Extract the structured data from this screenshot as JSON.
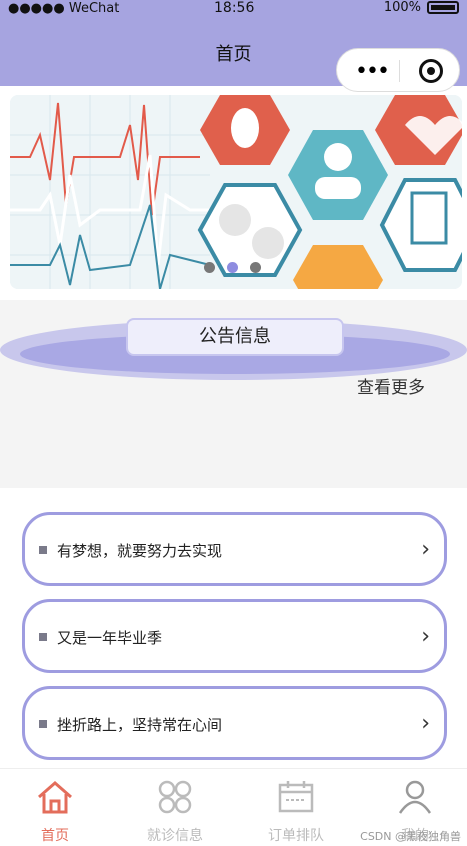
{
  "status": {
    "signal": "●●●●● WeChat",
    "time": "18:56",
    "battery": "100%"
  },
  "nav": {
    "title": "首页"
  },
  "notice": {
    "title": "公告信息",
    "more": "查看更多"
  },
  "list": [
    {
      "text": "有梦想，就要努力去实现"
    },
    {
      "text": "又是一年毕业季"
    },
    {
      "text": "挫折路上，坚持常在心间"
    }
  ],
  "tabs": [
    {
      "label": "首页",
      "active": true
    },
    {
      "label": "就诊信息",
      "active": false
    },
    {
      "label": "订单排队",
      "active": false
    },
    {
      "label": "我的",
      "active": false
    }
  ],
  "watermark": "CSDN @黑夜独角兽",
  "colors": {
    "header": "#a6a4e0",
    "accent": "#e36d5b",
    "card_border": "#9e9ce0"
  }
}
